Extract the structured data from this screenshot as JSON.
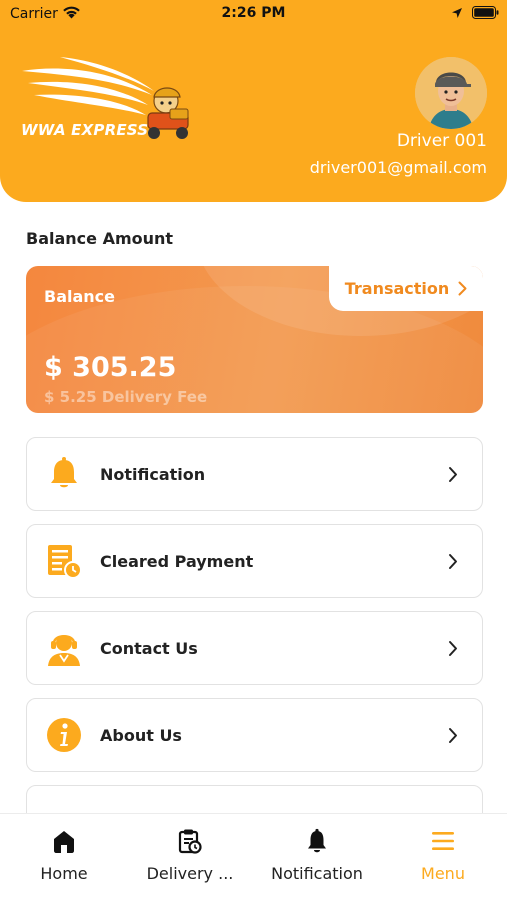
{
  "status_bar": {
    "carrier": "Carrier",
    "time": "2:26 PM"
  },
  "header": {
    "logo_text": "WWA EXPRESS",
    "driver_name": "Driver 001",
    "driver_email": "driver001@gmail.com"
  },
  "balance": {
    "section_title": "Balance Amount",
    "label": "Balance",
    "amount": "$ 305.25",
    "delivery_fee": "$ 5.25 Delivery Fee",
    "transaction_label": "Transaction"
  },
  "menu": {
    "items": [
      {
        "label": "Notification",
        "icon": "bell-icon"
      },
      {
        "label": "Cleared Payment",
        "icon": "payment-document-icon"
      },
      {
        "label": "Contact Us",
        "icon": "support-agent-icon"
      },
      {
        "label": "About Us",
        "icon": "info-icon"
      }
    ]
  },
  "tabbar": {
    "tabs": [
      {
        "label": "Home",
        "icon": "home-icon",
        "active": false
      },
      {
        "label": "Delivery ...",
        "icon": "delivery-clipboard-icon",
        "active": false
      },
      {
        "label": "Notification",
        "icon": "bell-icon",
        "active": false
      },
      {
        "label": "Menu",
        "icon": "menu-icon",
        "active": true
      }
    ]
  },
  "colors": {
    "brand": "#FCAA1E",
    "card_orange": "#F39A50",
    "accent_text": "#F08A1F"
  }
}
